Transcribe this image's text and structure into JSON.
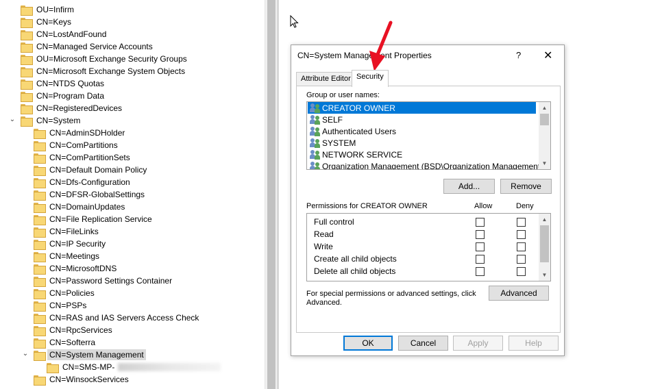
{
  "tree": {
    "items": [
      {
        "label": "OU=Infirm",
        "level": 1
      },
      {
        "label": "CN=Keys",
        "level": 1
      },
      {
        "label": "CN=LostAndFound",
        "level": 1
      },
      {
        "label": "CN=Managed Service Accounts",
        "level": 1
      },
      {
        "label": "OU=Microsoft Exchange Security Groups",
        "level": 1
      },
      {
        "label": "CN=Microsoft Exchange System Objects",
        "level": 1
      },
      {
        "label": "CN=NTDS Quotas",
        "level": 1
      },
      {
        "label": "CN=Program Data",
        "level": 1
      },
      {
        "label": "CN=RegisteredDevices",
        "level": 1
      },
      {
        "label": "CN=System",
        "level": 1,
        "expanded": true
      },
      {
        "label": "CN=AdminSDHolder",
        "level": 2
      },
      {
        "label": "CN=ComPartitions",
        "level": 2
      },
      {
        "label": "CN=ComPartitionSets",
        "level": 2
      },
      {
        "label": "CN=Default Domain Policy",
        "level": 2
      },
      {
        "label": "CN=Dfs-Configuration",
        "level": 2
      },
      {
        "label": "CN=DFSR-GlobalSettings",
        "level": 2
      },
      {
        "label": "CN=DomainUpdates",
        "level": 2
      },
      {
        "label": "CN=File Replication Service",
        "level": 2
      },
      {
        "label": "CN=FileLinks",
        "level": 2
      },
      {
        "label": "CN=IP Security",
        "level": 2
      },
      {
        "label": "CN=Meetings",
        "level": 2
      },
      {
        "label": "CN=MicrosoftDNS",
        "level": 2
      },
      {
        "label": "CN=Password Settings Container",
        "level": 2
      },
      {
        "label": "CN=Policies",
        "level": 2
      },
      {
        "label": "CN=PSPs",
        "level": 2
      },
      {
        "label": "CN=RAS and IAS Servers Access Check",
        "level": 2
      },
      {
        "label": "CN=RpcServices",
        "level": 2
      },
      {
        "label": "CN=Softerra",
        "level": 2
      },
      {
        "label": "CN=System Management",
        "level": 2,
        "expanded": true,
        "selected": true
      },
      {
        "label": "CN=SMS-MP-",
        "level": 3
      },
      {
        "label": "CN=WinsockServices",
        "level": 2
      }
    ]
  },
  "dialog": {
    "title": "CN=System Management Properties",
    "help_label": "?",
    "close_label": "✕",
    "tabs": [
      "Attribute Editor",
      "Security"
    ],
    "active_tab": "Security",
    "group_label": "Group or user names:",
    "users": [
      "CREATOR OWNER",
      "SELF",
      "Authenticated Users",
      "SYSTEM",
      "NETWORK SERVICE",
      "Organization Management (BSD\\Organization Management)"
    ],
    "selected_user": "CREATOR OWNER",
    "add_label": "Add...",
    "remove_label": "Remove",
    "permissions_label": "Permissions for CREATOR OWNER",
    "allow_label": "Allow",
    "deny_label": "Deny",
    "permissions": [
      {
        "name": "Full control",
        "allow": false,
        "deny": false
      },
      {
        "name": "Read",
        "allow": false,
        "deny": false
      },
      {
        "name": "Write",
        "allow": false,
        "deny": false
      },
      {
        "name": "Create all child objects",
        "allow": false,
        "deny": false
      },
      {
        "name": "Delete all child objects",
        "allow": false,
        "deny": false
      }
    ],
    "special_text_1": "For special permissions or advanced settings, click",
    "special_text_2": "Advanced.",
    "advanced_label": "Advanced",
    "ok_label": "OK",
    "cancel_label": "Cancel",
    "apply_label": "Apply",
    "help_button_label": "Help"
  },
  "colors": {
    "selection": "#0078d7",
    "annotation_arrow": "#e81123"
  }
}
